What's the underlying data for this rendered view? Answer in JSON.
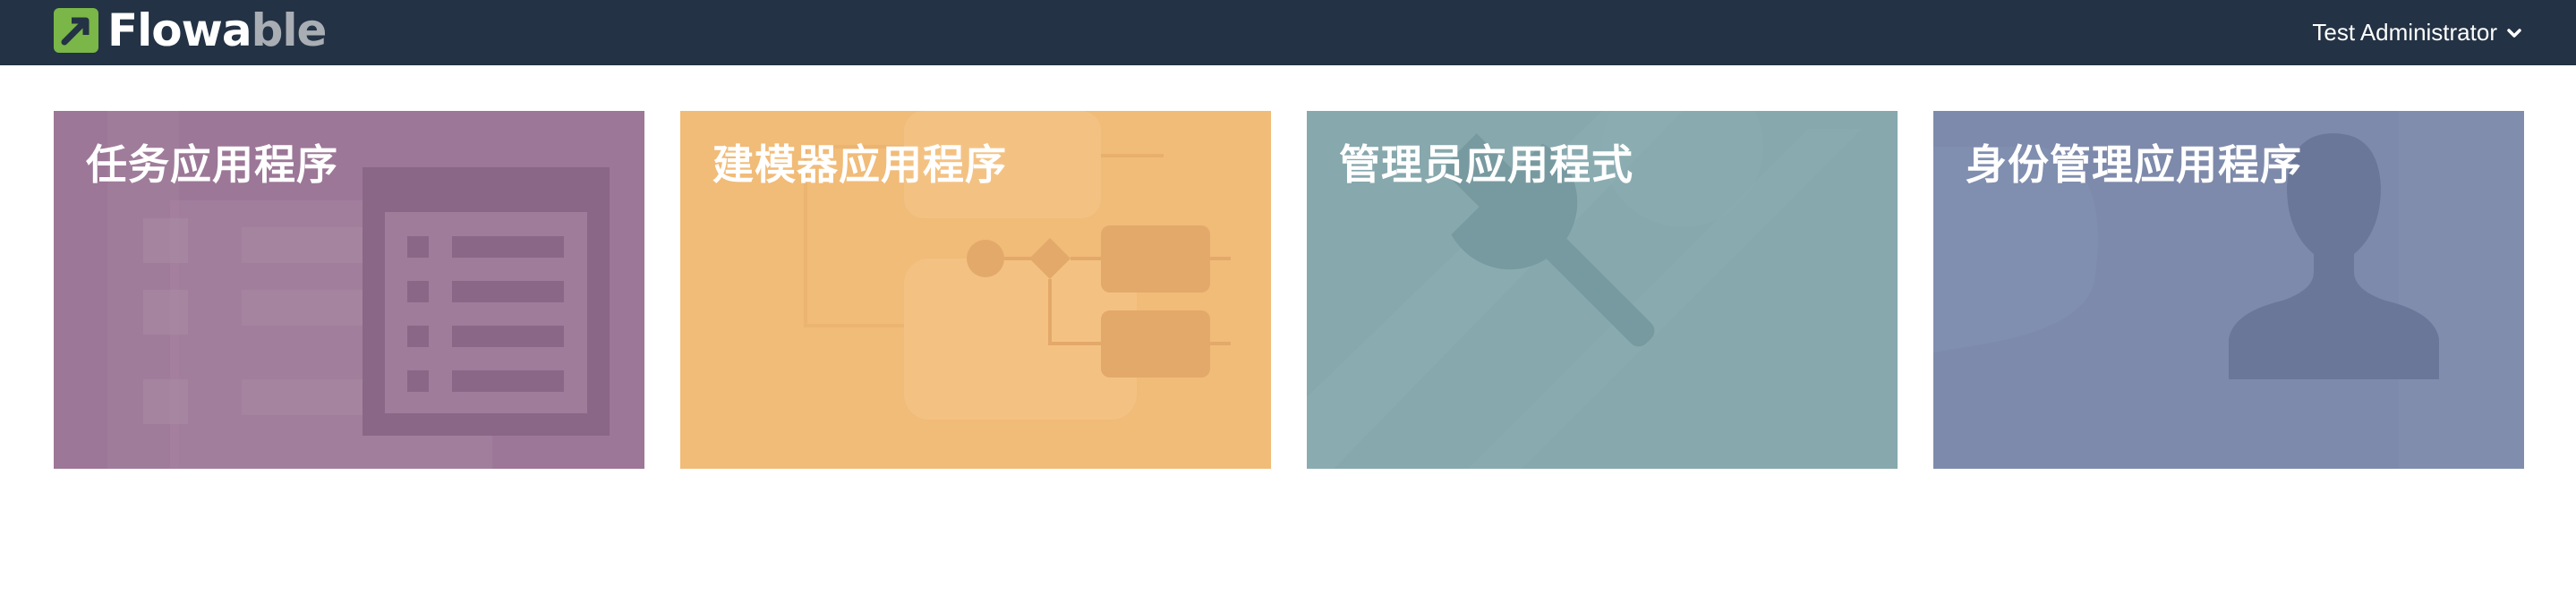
{
  "header": {
    "logo": {
      "prefix": "Flo",
      "middle": "wa",
      "suffix": "ble",
      "icon": "flowable-logo-icon"
    },
    "user_name": "Test Administrator",
    "user_menu_icon": "chevron-down-icon"
  },
  "apps": [
    {
      "title": "任务应用程序",
      "icon": "task-list-icon",
      "color": "#9c7797"
    },
    {
      "title": "建模器应用程序",
      "icon": "process-diagram-icon",
      "color": "#f1bb78"
    },
    {
      "title": "管理员应用程式",
      "icon": "wrench-icon",
      "color": "#87a8ad"
    },
    {
      "title": "身份管理应用程序",
      "icon": "user-silhouette-icon",
      "color": "#7e8aab"
    }
  ],
  "colors": {
    "header_bg": "#233244",
    "logo_green": "#7ab648"
  }
}
